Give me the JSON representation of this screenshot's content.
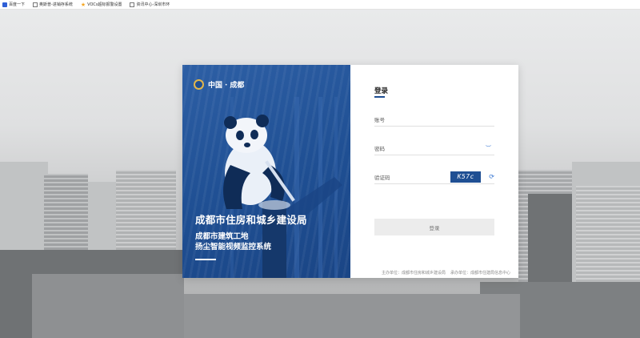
{
  "bookmarks": [
    {
      "icon": "baidu-icon",
      "label": "百度一下"
    },
    {
      "icon": "document-icon",
      "label": "奥斯普-进销存系统"
    },
    {
      "icon": "star-icon",
      "label": "VOCs超标报警设置"
    },
    {
      "icon": "document-icon",
      "label": "资讯中心-深圳市环"
    }
  ],
  "brand": {
    "logo_text": "中国 · 成都",
    "bureau": "成都市住房和城乡建设局",
    "subtitle_line1": "成都市建筑工地",
    "subtitle_line2": "扬尘智能视频监控系统"
  },
  "form": {
    "title": "登录",
    "account_placeholder": "账号",
    "password_placeholder": "密码",
    "captcha_placeholder": "验证码",
    "captcha_code": "K57c",
    "login_label": "登录"
  },
  "footer": {
    "organizer": "主办单位：成都市住房和城乡建设局",
    "undertaker": "承办单位：成都市住建局信息中心"
  },
  "colors": {
    "brand_blue": "#1f4f93",
    "accent_blue": "#2d6fd0",
    "logo_gold": "#e3b64a"
  }
}
